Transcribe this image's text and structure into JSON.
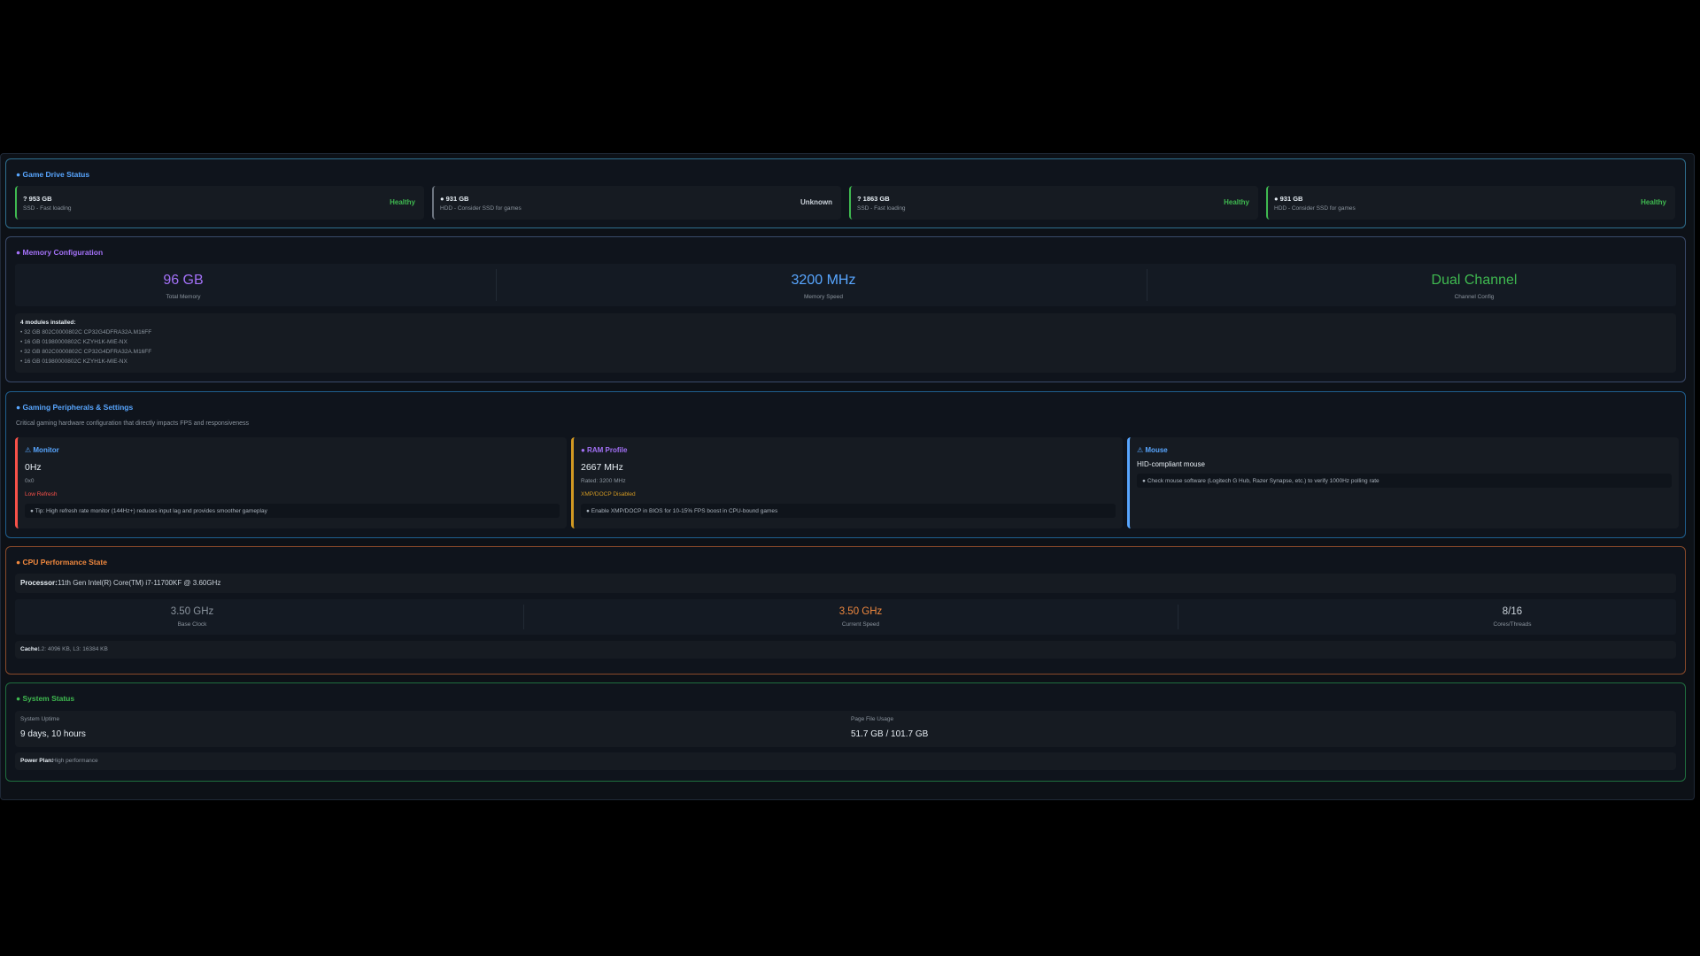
{
  "drive_section": {
    "title": "● Game Drive Status",
    "drives": [
      {
        "size": "? 953 GB",
        "type": "SSD - Fast loading",
        "health": "Healthy",
        "color": "#3fb950"
      },
      {
        "size": "● 931 GB",
        "type": "HDD - Consider SSD for games",
        "health": "Unknown",
        "color": "#c9d1d9"
      },
      {
        "size": "? 1863 GB",
        "type": "SSD - Fast loading",
        "health": "Healthy",
        "color": "#3fb950"
      },
      {
        "size": "● 931 GB",
        "type": "HDD - Consider SSD for games",
        "health": "Healthy",
        "color": "#3fb950"
      }
    ]
  },
  "memory": {
    "title": "● Memory Configuration",
    "stats": [
      {
        "value": "96 GB",
        "label": "Total Memory",
        "color": "#a371f7"
      },
      {
        "value": "3200 MHz",
        "label": "Memory Speed",
        "color": "#58a6ff"
      },
      {
        "value": "Dual Channel",
        "label": "Channel Config",
        "color": "#3fb950"
      }
    ],
    "modules_header": "4 modules installed:",
    "modules": [
      "• 32 GB 802C0000802C CP32G4DFRA32A.M16FF",
      "• 16 GB 01980000802C KZYH1K-MIE-NX",
      "• 32 GB 802C0000802C CP32G4DFRA32A.M16FF",
      "• 16 GB 01980000802C KZYH1K-MIE-NX"
    ]
  },
  "peripherals": {
    "title": "● Gaming Peripherals & Settings",
    "subtitle": "Critical gaming hardware configuration that directly impacts FPS and responsiveness",
    "monitor": {
      "title": "⚠ Monitor",
      "value": "0Hz",
      "line1": "0x0",
      "line2": "Low Refresh",
      "tip": "● Tip: High refresh rate monitor (144Hz+) reduces input lag and provides smoother gameplay"
    },
    "ram": {
      "title": "● RAM Profile",
      "value": "2667 MHz",
      "line1": "Rated: 3200 MHz",
      "line2": "XMP/DOCP Disabled",
      "tip": "● Enable XMP/DOCP in BIOS for 10-15% FPS boost in CPU-bound games"
    },
    "mouse": {
      "title": "⚠ Mouse",
      "value": "HID-compliant mouse",
      "tip": "● Check mouse software (Logitech G Hub, Razer Synapse, etc.) to verify 1000Hz polling rate"
    }
  },
  "cpu": {
    "title": "● CPU Performance State",
    "processor_label": "Processor:",
    "processor_value": "11th Gen Intel(R) Core(TM) i7-11700KF @ 3.60GHz",
    "stats": [
      {
        "value": "3.50 GHz",
        "label": "Base Clock",
        "color": "#8b949e"
      },
      {
        "value": "3.50 GHz",
        "label": "Current Speed",
        "color": "#f0883e"
      },
      {
        "value": "8/16",
        "label": "Cores/Threads",
        "color": "#c9d1d9"
      }
    ],
    "cache_label": "Cache:",
    "cache_value": "L2: 4096 KB, L3: 16384 KB"
  },
  "status": {
    "title": "● System Status",
    "uptime_label": "System Uptime",
    "uptime_value": "9 days, 10 hours",
    "pagefile_label": "Page File Usage",
    "pagefile_value": "51.7 GB / 101.7 GB",
    "power_label": "Power Plan:",
    "power_value": "High performance"
  },
  "colors": {
    "drive_border": "#2f6f8f",
    "memory_border": "#3a4a6a",
    "peripheral_border": "#1f5f8f",
    "cpu_border": "#8a4a2a",
    "status_border": "#1f6f3f"
  }
}
